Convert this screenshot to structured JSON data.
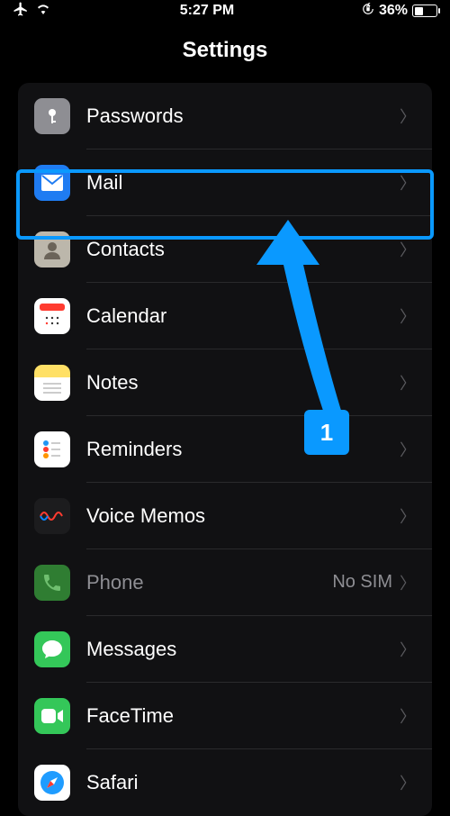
{
  "status": {
    "time": "5:27 PM",
    "battery_pct": "36%"
  },
  "header": {
    "title": "Settings"
  },
  "rows": {
    "passwords": "Passwords",
    "mail": "Mail",
    "contacts": "Contacts",
    "calendar": "Calendar",
    "notes": "Notes",
    "reminders": "Reminders",
    "voice_memos": "Voice Memos",
    "phone": "Phone",
    "phone_detail": "No SIM",
    "messages": "Messages",
    "facetime": "FaceTime",
    "safari": "Safari"
  },
  "annotation": {
    "badge": "1"
  },
  "colors": {
    "accent": "#0a99ff"
  }
}
